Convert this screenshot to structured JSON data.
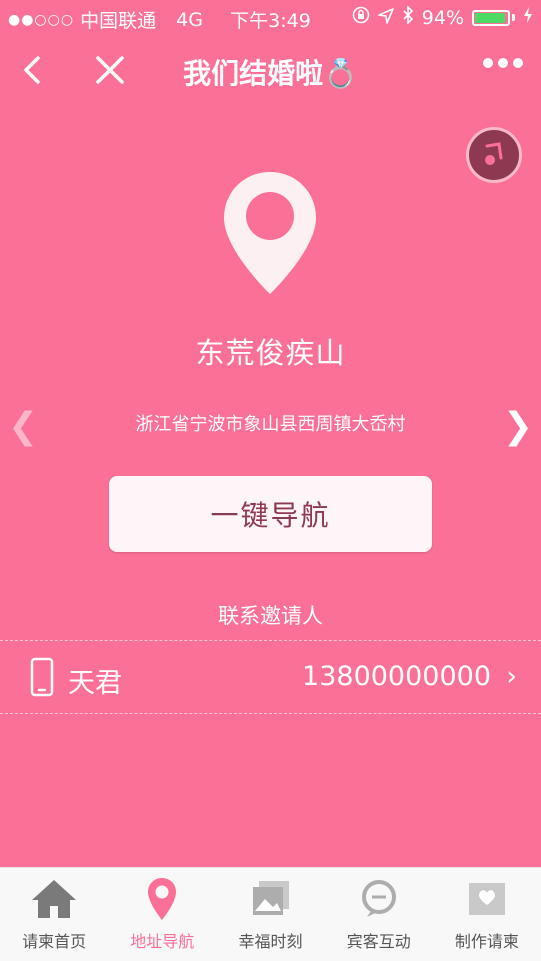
{
  "status_bar": {
    "signal": "●●○○○",
    "carrier": "中国联通",
    "network": "4G",
    "time": "下午3:49",
    "battery_percent": "94%",
    "battery_level": 0.94,
    "battery_color": "#4CD964"
  },
  "nav": {
    "title": "我们结婚啦💍"
  },
  "venue": {
    "name": "东荒俊疾山",
    "address": "浙江省宁波市象山县西周镇大岙村",
    "prev_arrow": "❮",
    "next_arrow": "❯"
  },
  "navigate_button": {
    "label": "一键导航"
  },
  "contact": {
    "title": "联系邀请人",
    "name": "天君",
    "phone": "13800000000",
    "chevron": "›"
  },
  "tabbar": {
    "tabs": [
      {
        "label": "请柬首页",
        "icon": "home-icon"
      },
      {
        "label": "地址导航",
        "icon": "location-pin-icon",
        "active": true
      },
      {
        "label": "幸福时刻",
        "icon": "photo-icon"
      },
      {
        "label": "宾客互动",
        "icon": "chat-icon"
      },
      {
        "label": "制作请柬",
        "icon": "card-icon"
      }
    ]
  },
  "colors": {
    "background": "#FB7096",
    "accent_dark": "#8E3952",
    "button_bg": "#FDF5F7"
  }
}
